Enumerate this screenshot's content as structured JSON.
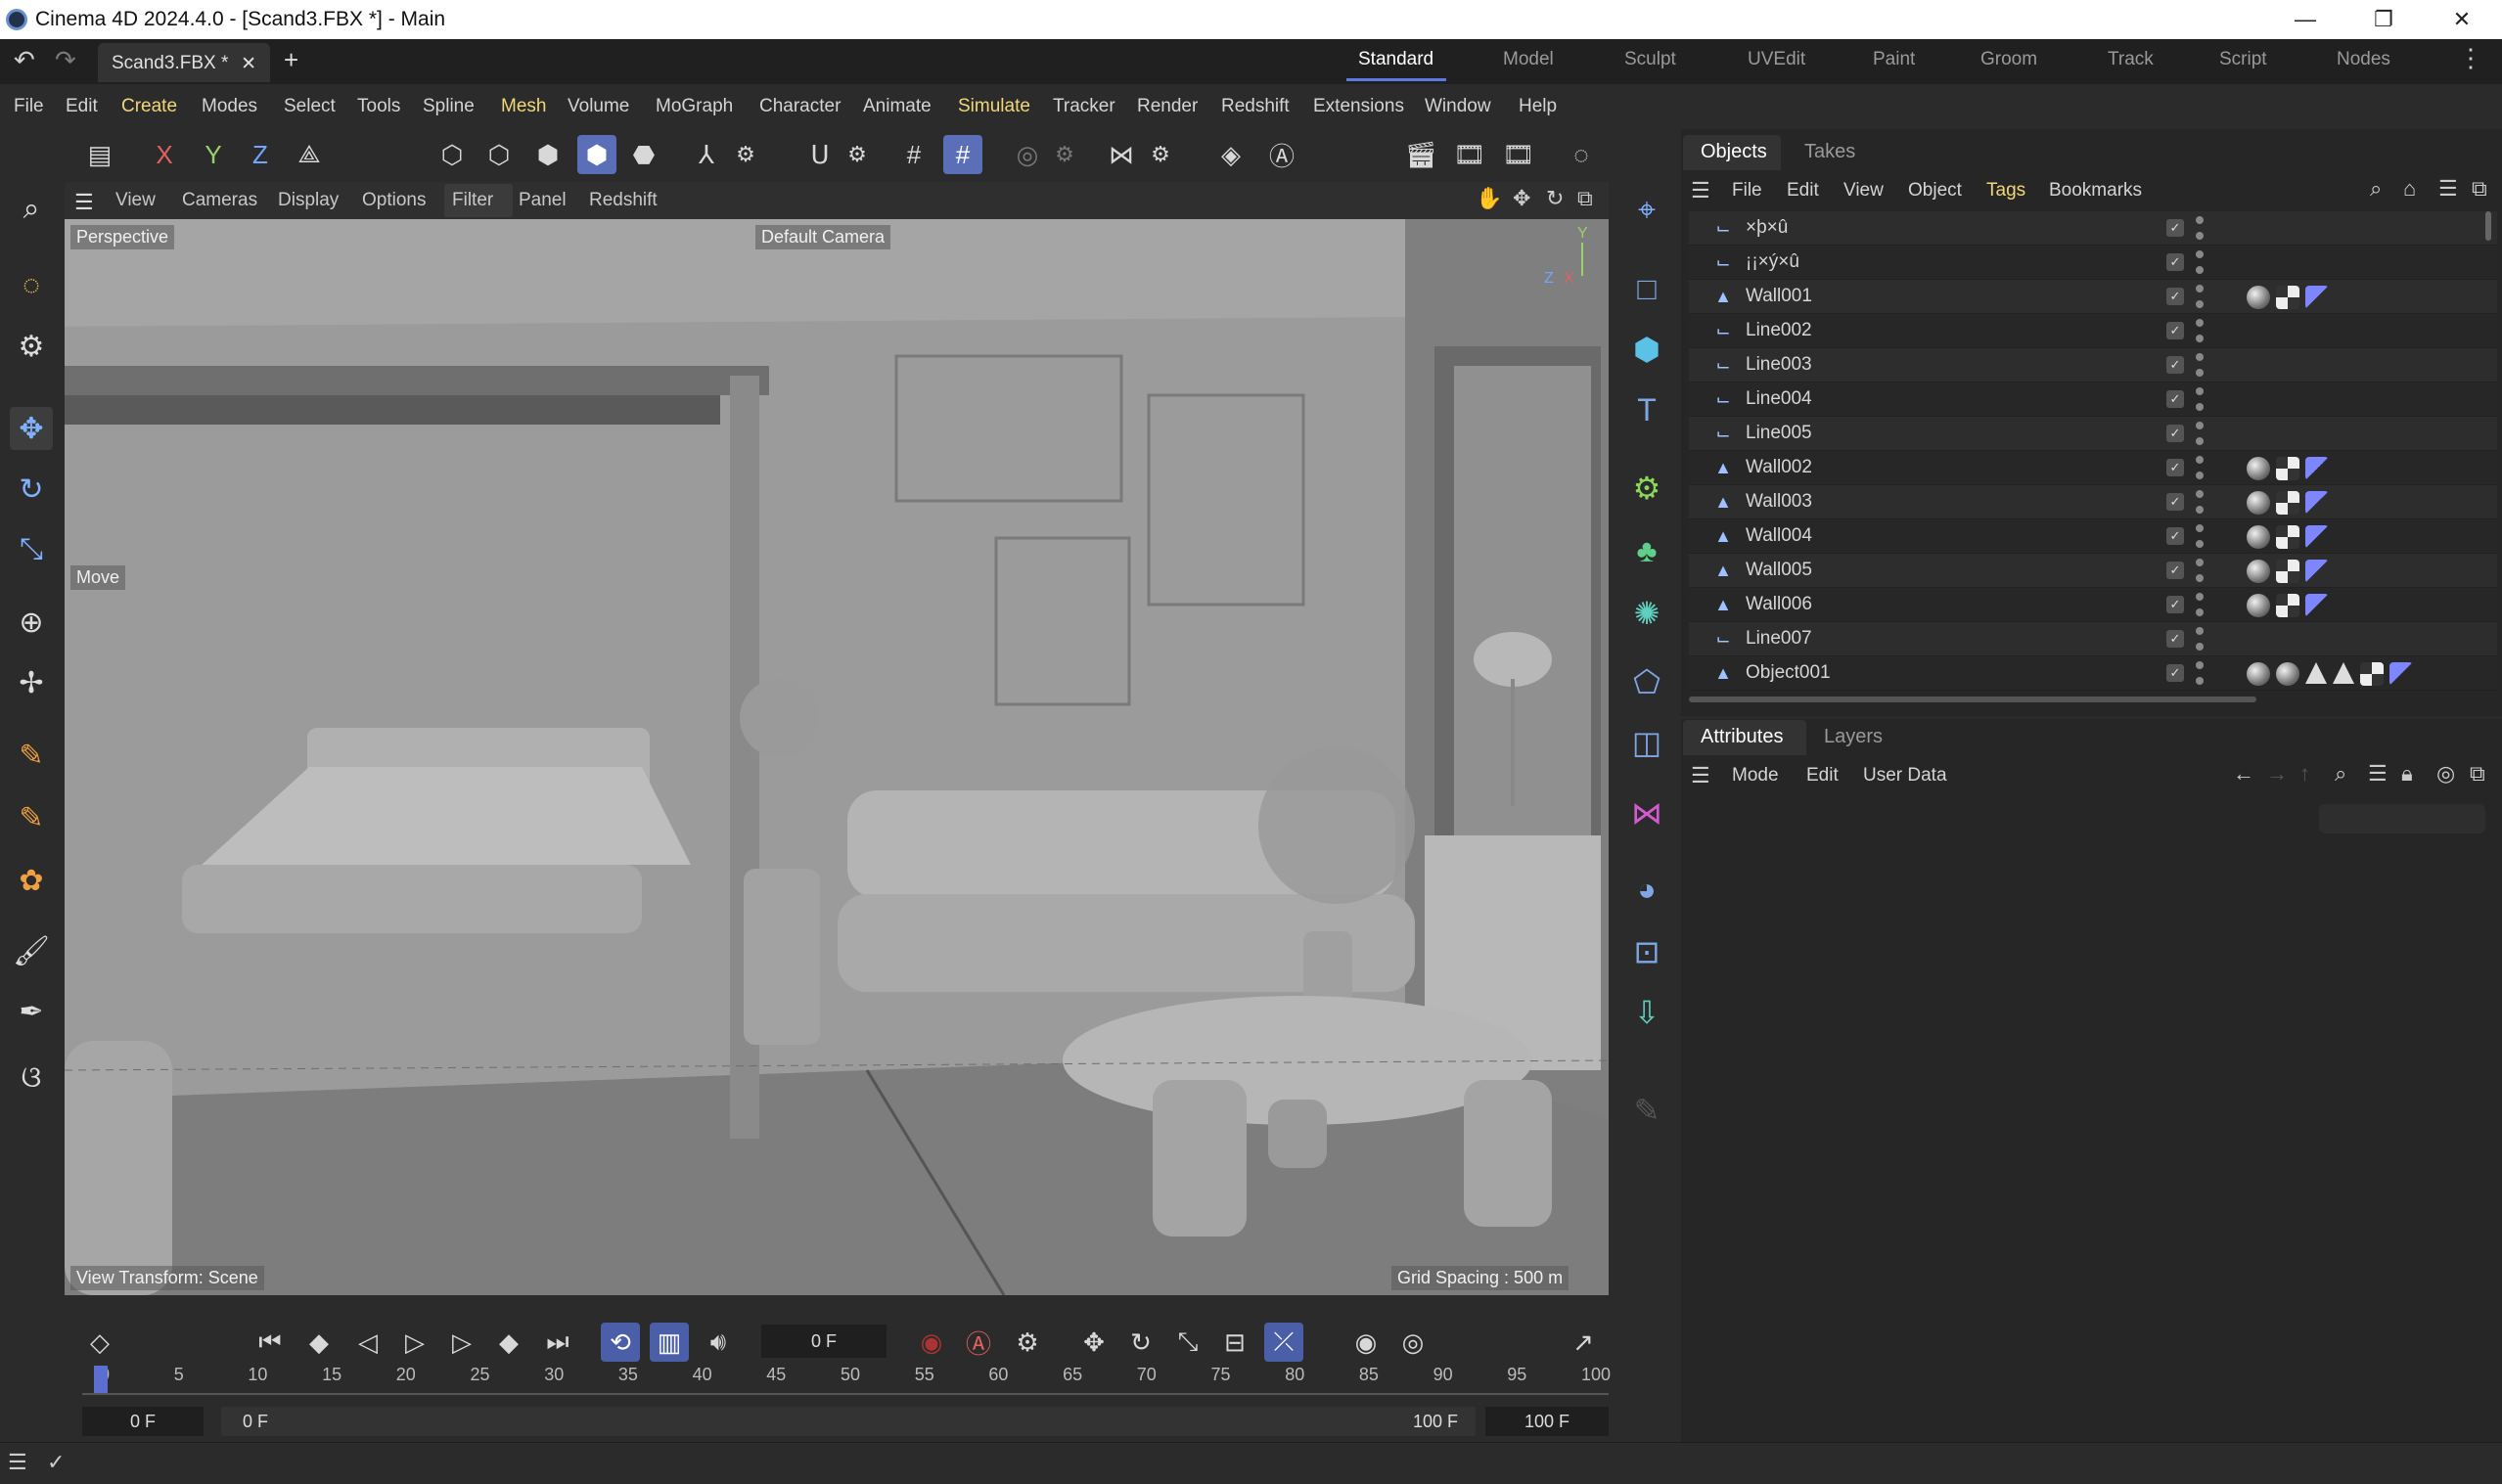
{
  "window": {
    "title": "Cinema 4D 2024.4.0 - [Scand3.FBX *] - Main",
    "minimize": "—",
    "maximize": "❐",
    "close": "✕"
  },
  "tabs": {
    "doc_label": "Scand3.FBX *",
    "close": "✕",
    "add": "+"
  },
  "workspaces": [
    {
      "label": "Standard",
      "active": true
    },
    {
      "label": "Model"
    },
    {
      "label": "Sculpt"
    },
    {
      "label": "UVEdit"
    },
    {
      "label": "Paint"
    },
    {
      "label": "Groom"
    },
    {
      "label": "Track"
    },
    {
      "label": "Script"
    },
    {
      "label": "Nodes"
    }
  ],
  "menus": [
    "File",
    "Edit",
    "Create",
    "Modes",
    "Select",
    "Tools",
    "Spline",
    "Mesh",
    "Volume",
    "MoGraph",
    "Character",
    "Animate",
    "Simulate",
    "Tracker",
    "Render",
    "Redshift",
    "Extensions",
    "Window",
    "Help"
  ],
  "toolbar": {
    "x": "X",
    "y": "Y",
    "z": "Z"
  },
  "viewport": {
    "menu": [
      "View",
      "Cameras",
      "Display",
      "Options",
      "Filter",
      "Panel",
      "Redshift"
    ],
    "perspective": "Perspective",
    "camera": "Default Camera",
    "move_label": "Move",
    "view_transform": "View Transform: Scene",
    "grid_spacing": "Grid Spacing : 500 m",
    "axis_y": "Y",
    "axis_z": "Z",
    "axis_x": "X"
  },
  "objects_panel": {
    "tabs": [
      "Objects",
      "Takes"
    ],
    "menu": [
      "File",
      "Edit",
      "View",
      "Object",
      "Tags",
      "Bookmarks"
    ],
    "items": [
      {
        "name": "×þ×û",
        "type": "spline",
        "tags": []
      },
      {
        "name": "¡¡×ý×û",
        "type": "spline",
        "tags": []
      },
      {
        "name": "Wall001",
        "type": "poly",
        "tags": [
          "mat",
          "chk",
          "uv"
        ]
      },
      {
        "name": "Line002",
        "type": "spline",
        "tags": []
      },
      {
        "name": "Line003",
        "type": "spline",
        "tags": []
      },
      {
        "name": "Line004",
        "type": "spline",
        "tags": []
      },
      {
        "name": "Line005",
        "type": "spline",
        "tags": []
      },
      {
        "name": "Wall002",
        "type": "poly",
        "tags": [
          "mat",
          "chk",
          "uv"
        ]
      },
      {
        "name": "Wall003",
        "type": "poly",
        "tags": [
          "mat",
          "chk",
          "uv"
        ]
      },
      {
        "name": "Wall004",
        "type": "poly",
        "tags": [
          "mat",
          "chk",
          "uv"
        ]
      },
      {
        "name": "Wall005",
        "type": "poly",
        "tags": [
          "mat",
          "chk",
          "uv"
        ]
      },
      {
        "name": "Wall006",
        "type": "poly",
        "tags": [
          "mat",
          "chk",
          "uv"
        ]
      },
      {
        "name": "Line007",
        "type": "spline",
        "tags": []
      },
      {
        "name": "Object001",
        "type": "poly",
        "tags": [
          "mat",
          "mat",
          "tri",
          "tri",
          "chk",
          "uv"
        ]
      }
    ]
  },
  "attributes_panel": {
    "tabs": [
      "Attributes",
      "Layers"
    ],
    "menu": [
      "Mode",
      "Edit",
      "User Data"
    ]
  },
  "timeline": {
    "current_frame": "0 F",
    "ticks": [
      "0",
      "5",
      "10",
      "15",
      "20",
      "25",
      "30",
      "35",
      "40",
      "45",
      "50",
      "55",
      "60",
      "65",
      "70",
      "75",
      "80",
      "85",
      "90",
      "95",
      "100"
    ],
    "start_field": "0 F",
    "range_start": "0 F",
    "range_end": "100 F",
    "end_field": "100 F"
  }
}
